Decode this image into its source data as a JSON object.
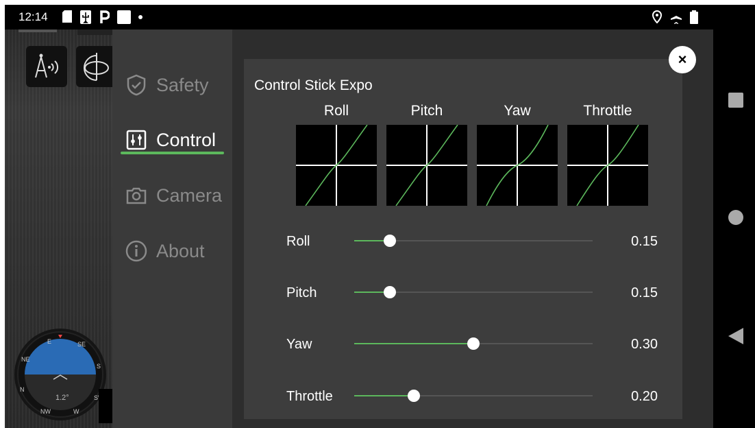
{
  "status_bar": {
    "time": "12:14",
    "icons_left": [
      "sd-card-icon",
      "usb-icon",
      "parking-icon",
      "square-notification-icon",
      "dot-icon"
    ],
    "icons_right": [
      "location-icon",
      "airplane-mode-icon",
      "battery-icon"
    ]
  },
  "side_menu": {
    "items": [
      {
        "id": "safety",
        "label": "Safety",
        "icon": "shield-check-icon",
        "active": false
      },
      {
        "id": "control",
        "label": "Control",
        "icon": "sliders-icon",
        "active": true
      },
      {
        "id": "camera",
        "label": "Camera",
        "icon": "camera-icon",
        "active": false
      },
      {
        "id": "about",
        "label": "About",
        "icon": "info-icon",
        "active": false
      }
    ]
  },
  "hud": {
    "compass_tilt": "1.2°",
    "compass_dirs": [
      "E",
      "SE",
      "S",
      "SW",
      "W",
      "NW",
      "N",
      "NE"
    ]
  },
  "panel": {
    "title": "Control Stick Expo",
    "curves": [
      {
        "label": "Roll"
      },
      {
        "label": "Pitch"
      },
      {
        "label": "Yaw"
      },
      {
        "label": "Throttle"
      }
    ],
    "sliders": [
      {
        "label": "Roll",
        "value": "0.15",
        "fraction": 0.15
      },
      {
        "label": "Pitch",
        "value": "0.15",
        "fraction": 0.15
      },
      {
        "label": "Yaw",
        "value": "0.30",
        "fraction": 0.5
      },
      {
        "label": "Throttle",
        "value": "0.20",
        "fraction": 0.25
      }
    ]
  },
  "colors": {
    "accent": "#5cb85c",
    "panel": "#3d3d3d",
    "menu": "#3a3a3a"
  },
  "close_button": {
    "icon": "close-icon",
    "symbol": "×"
  }
}
